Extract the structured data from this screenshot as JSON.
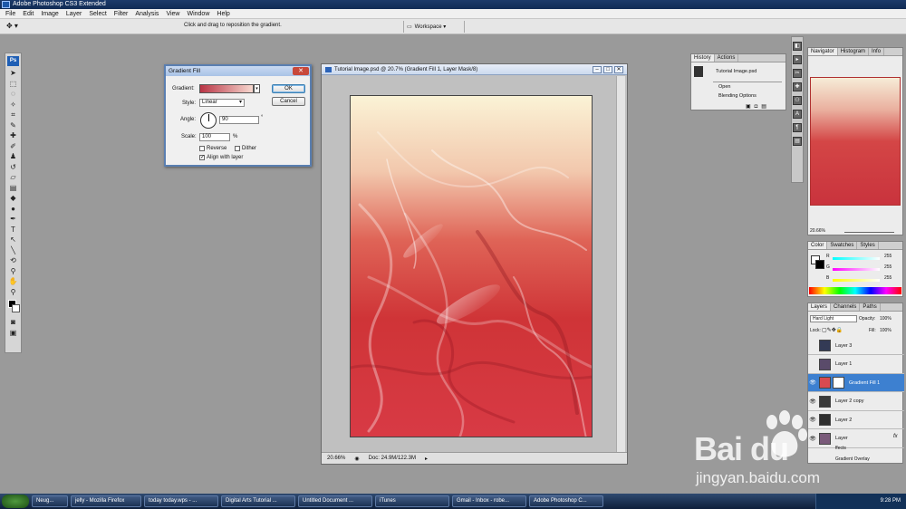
{
  "app": {
    "title": "Adobe Photoshop CS3 Extended"
  },
  "menu": [
    "File",
    "Edit",
    "Image",
    "Layer",
    "Select",
    "Filter",
    "Analysis",
    "View",
    "Window",
    "Help"
  ],
  "options_bar": {
    "hint": "Click and drag to reposition the gradient.",
    "workspace_label": "Workspace ▾"
  },
  "toolbox": {
    "logo": "Ps"
  },
  "gradient_dialog": {
    "title": "Gradient Fill",
    "gradient_label": "Gradient:",
    "style_label": "Style:",
    "style_value": "Linear",
    "angle_label": "Angle:",
    "angle_value": "90",
    "angle_unit": "°",
    "scale_label": "Scale:",
    "scale_value": "100",
    "scale_unit": "%",
    "reverse_label": "Reverse",
    "dither_label": "Dither",
    "align_label": "Align with layer",
    "align_checked": "✓",
    "ok_label": "OK",
    "cancel_label": "Cancel",
    "close_glyph": "✕"
  },
  "document": {
    "title": "Tutorial Image.psd @ 20.7% (Gradient Fill 1, Layer Mask/8)",
    "zoom": "20.66%",
    "doc_size": "Doc: 24.9M/122.3M"
  },
  "history_panel": {
    "tabs": [
      "History",
      "Actions"
    ],
    "snapshot": "Tutorial Image.psd",
    "items": [
      "Open",
      "Blending Options"
    ]
  },
  "navigator_panel": {
    "tabs": [
      "Navigator",
      "Histogram",
      "Info"
    ],
    "zoom": "20.66%"
  },
  "color_panel": {
    "tabs": [
      "Color",
      "Swatches",
      "Styles"
    ],
    "channels": [
      {
        "label": "R",
        "value": "255"
      },
      {
        "label": "G",
        "value": "255"
      },
      {
        "label": "B",
        "value": "255"
      }
    ]
  },
  "layers_panel": {
    "tabs": [
      "Layers",
      "Channels",
      "Paths"
    ],
    "blend_mode": "Hard Light",
    "opacity_label": "Opacity:",
    "opacity_value": "100%",
    "lock_label": "Lock:",
    "fill_label": "Fill:",
    "fill_value": "100%",
    "layers": [
      {
        "name": "Layer 3",
        "visible": "",
        "selected": false
      },
      {
        "name": "Layer 1",
        "visible": "",
        "selected": false
      },
      {
        "name": "Gradient Fill 1",
        "visible": "👁",
        "selected": true
      },
      {
        "name": "Layer 2 copy",
        "visible": "👁",
        "selected": false
      },
      {
        "name": "Layer 2",
        "visible": "👁",
        "selected": false
      },
      {
        "name": "Layer",
        "visible": "👁",
        "selected": false
      }
    ],
    "effects_label": "ffects",
    "effect_item": "Gradient Overlay"
  },
  "taskbar": {
    "items": [
      "Neug...",
      "jelly - Mozilla Firefox",
      "today today.wps - ...",
      "Digital Arts Tutorial ...",
      "Untitled Document ...",
      "iTunes",
      "Gmail - Inbox - robe...",
      "Adobe Photoshop C..."
    ],
    "clock": "9:28 PM"
  },
  "watermark": {
    "brand": "Bai du",
    "url": "jingyan.baidu.com"
  },
  "colors": {
    "accent": "#3d80d0",
    "image_top": "#f8ecd0",
    "image_mid": "#d8423f",
    "image_bottom": "#c32b3b"
  }
}
